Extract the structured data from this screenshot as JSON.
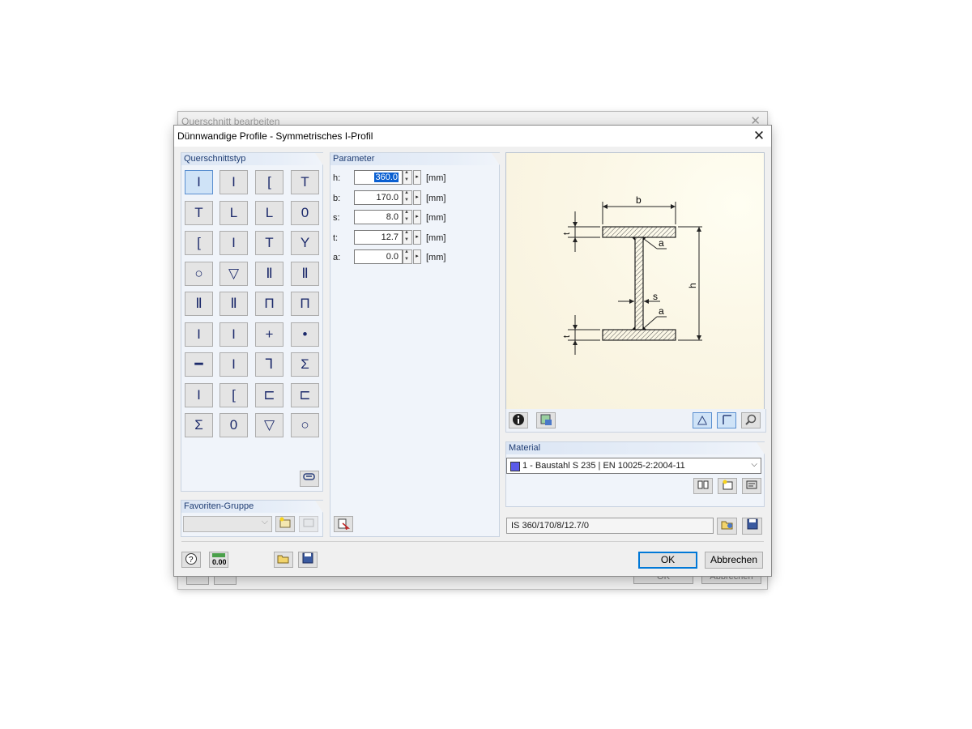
{
  "background_dialog": {
    "title": "Querschnitt bearbeiten",
    "ok_label": "OK",
    "cancel_label": "Abbrechen"
  },
  "dialog": {
    "title": "Dünnwandige Profile - Symmetrisches I-Profil",
    "close_icon": "close-icon"
  },
  "section_type": {
    "header": "Querschnittstyp",
    "buttons": [
      "I",
      "I",
      "[",
      "T",
      "T",
      "L",
      "L",
      "0",
      "[",
      "I",
      "T",
      "Y",
      "○",
      "▽",
      "Ⅱ",
      "Ⅱ",
      "Ⅱ",
      "Ⅱ",
      "Π",
      "Π",
      "I",
      "I",
      "+",
      "•",
      "━",
      "I",
      "⅂",
      "Ʃ",
      "I",
      "[",
      "⊏",
      "⊏",
      "Σ",
      "0",
      "▽",
      "○"
    ],
    "selected_index": 0
  },
  "favorites": {
    "header": "Favoriten-Gruppe"
  },
  "parameters": {
    "header": "Parameter",
    "rows": [
      {
        "label": "h:",
        "value": "360.0",
        "unit": "[mm]"
      },
      {
        "label": "b:",
        "value": "170.0",
        "unit": "[mm]"
      },
      {
        "label": "s:",
        "value": "8.0",
        "unit": "[mm]"
      },
      {
        "label": "t:",
        "value": "12.7",
        "unit": "[mm]"
      },
      {
        "label": "a:",
        "value": "0.0",
        "unit": "[mm]"
      }
    ]
  },
  "drawing": {
    "labels": {
      "b": "b",
      "h": "h",
      "s": "s",
      "t_top": "t",
      "t_bottom": "t",
      "a_top": "a",
      "a_bottom": "a"
    }
  },
  "material": {
    "header": "Material",
    "selected": "1 - Baustahl S 235 | EN 10025-2:2004-11",
    "swatch_color": "#5b5be8"
  },
  "section_name": "IS 360/170/8/12.7/0",
  "footer": {
    "ok_label": "OK",
    "cancel_label": "Abbrechen"
  }
}
